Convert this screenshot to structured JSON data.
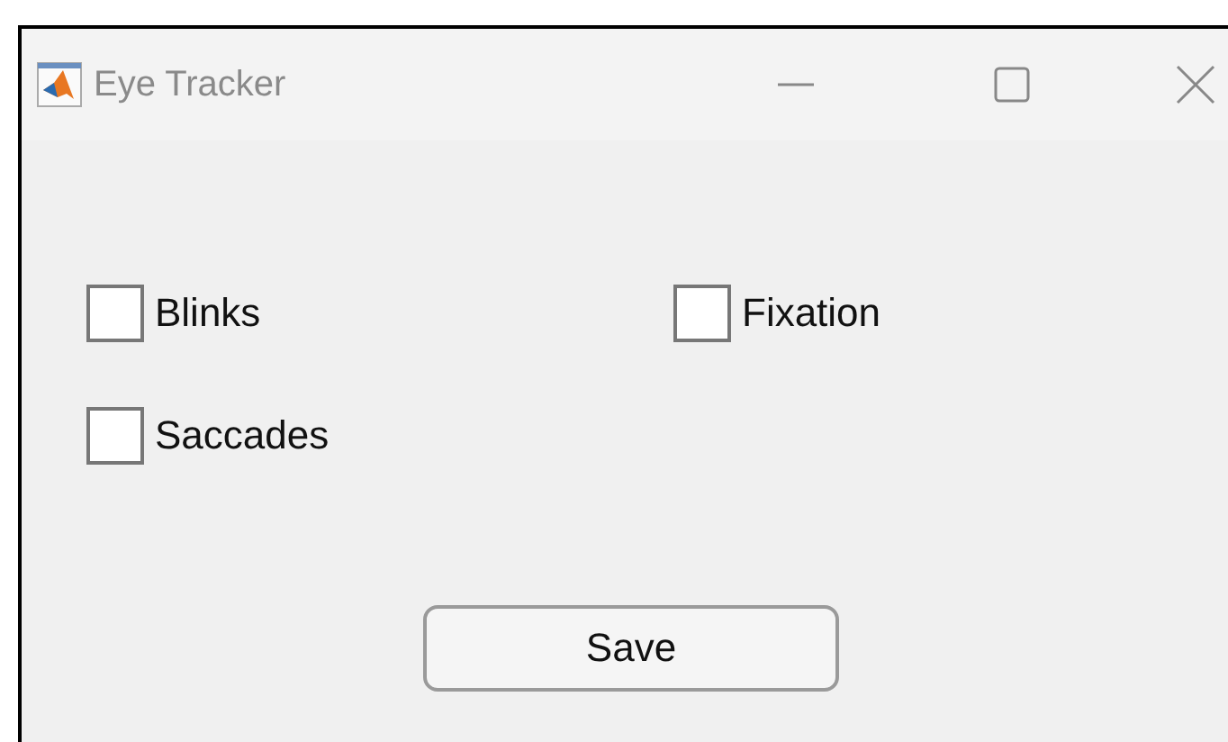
{
  "window": {
    "title": "Eye Tracker"
  },
  "checkboxes": [
    {
      "label": "Blinks",
      "checked": false
    },
    {
      "label": "Fixation",
      "checked": false
    },
    {
      "label": "Saccades",
      "checked": false
    }
  ],
  "buttons": [
    "Save"
  ]
}
